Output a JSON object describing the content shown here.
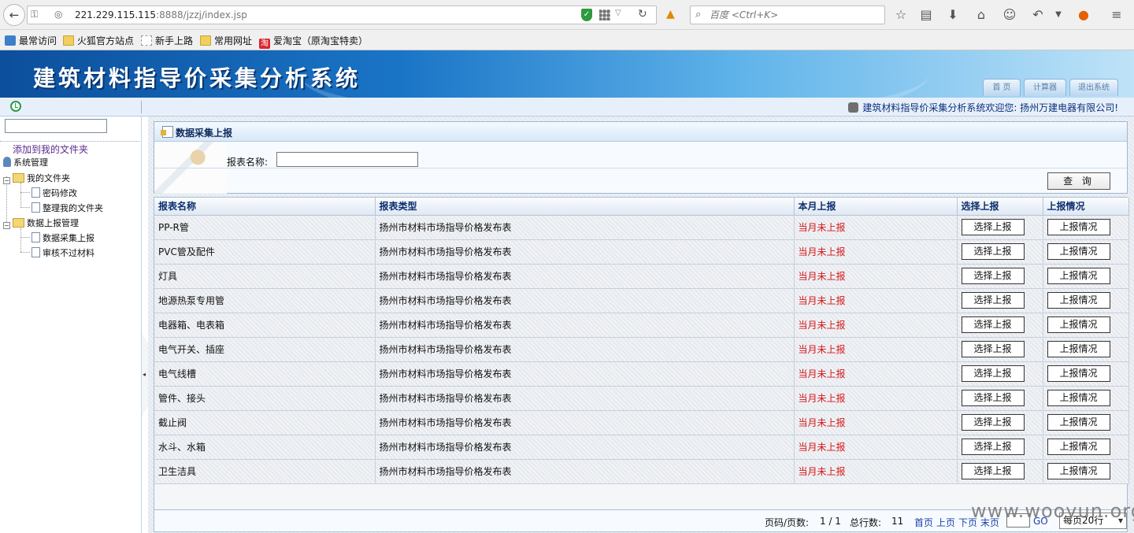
{
  "browser": {
    "url_host": "221.229.115.115",
    "url_rest": ":8888/jzzj/index.jsp",
    "search_placeholder": "百度 <Ctrl+K>"
  },
  "bookmarks": [
    {
      "label": "最常访问",
      "icon": "star-icon"
    },
    {
      "label": "火狐官方站点",
      "icon": "folder-icon"
    },
    {
      "label": "新手上路",
      "icon": "page-icon"
    },
    {
      "label": "常用网址",
      "icon": "folder-icon"
    },
    {
      "label": "爱淘宝（原淘宝特卖）",
      "icon": "taobao-icon"
    }
  ],
  "header": {
    "title": "建筑材料指导价采集分析系统",
    "tabs": [
      "首 页",
      "计算器",
      "退出系统"
    ]
  },
  "infobar": {
    "welcome": "建筑材料指导价采集分析系统欢迎您: 扬州万建电器有限公司!"
  },
  "sidebar": {
    "add_folder": "添加到我的文件夹",
    "tree": {
      "system": "系统管理",
      "my_folder": "我的文件夹",
      "change_password": "密码修改",
      "organize_folder": "整理我的文件夹",
      "report_mgmt": "数据上报管理",
      "data_upload": "数据采集上报",
      "rejected": "审核不过材料"
    },
    "tree_glyph_minus": "−",
    "collapse_glyph": "◂"
  },
  "panel": {
    "title": "数据采集上报",
    "label_name": "报表名称:",
    "query_button": "查 询"
  },
  "table": {
    "headers": [
      "报表名称",
      "报表类型",
      "本月上报",
      "选择上报",
      "上报情况"
    ],
    "rows": [
      {
        "name": "PP-R管",
        "type": "扬州市材料市场指导价格发布表",
        "status": "当月未上报"
      },
      {
        "name": "PVC管及配件",
        "type": "扬州市材料市场指导价格发布表",
        "status": "当月未上报"
      },
      {
        "name": "灯具",
        "type": "扬州市材料市场指导价格发布表",
        "status": "当月未上报"
      },
      {
        "name": "地源热泵专用管",
        "type": "扬州市材料市场指导价格发布表",
        "status": "当月未上报"
      },
      {
        "name": "电器箱、电表箱",
        "type": "扬州市材料市场指导价格发布表",
        "status": "当月未上报"
      },
      {
        "name": "电气开关、插座",
        "type": "扬州市材料市场指导价格发布表",
        "status": "当月未上报"
      },
      {
        "name": "电气线槽",
        "type": "扬州市材料市场指导价格发布表",
        "status": "当月未上报"
      },
      {
        "name": "管件、接头",
        "type": "扬州市材料市场指导价格发布表",
        "status": "当月未上报"
      },
      {
        "name": "截止阀",
        "type": "扬州市材料市场指导价格发布表",
        "status": "当月未上报"
      },
      {
        "name": "水斗、水箱",
        "type": "扬州市材料市场指导价格发布表",
        "status": "当月未上报"
      },
      {
        "name": "卫生洁具",
        "type": "扬州市材料市场指导价格发布表",
        "status": "当月未上报"
      }
    ],
    "select_button": "选择上报",
    "status_button": "上报情况"
  },
  "pager": {
    "page_label": "页码/页数:",
    "page_value": "1 / 1",
    "total_label": "总行数:",
    "total_value": "11",
    "first": "首页",
    "prev": "上页",
    "next": "下页",
    "last": "末页",
    "go": "GO",
    "page_size": "每页20行"
  },
  "watermark": "www.wooyun.org",
  "colors": {
    "status_red": "#d81818",
    "link_blue": "#1a3fa8",
    "header_blue": "#0c4f9c"
  }
}
